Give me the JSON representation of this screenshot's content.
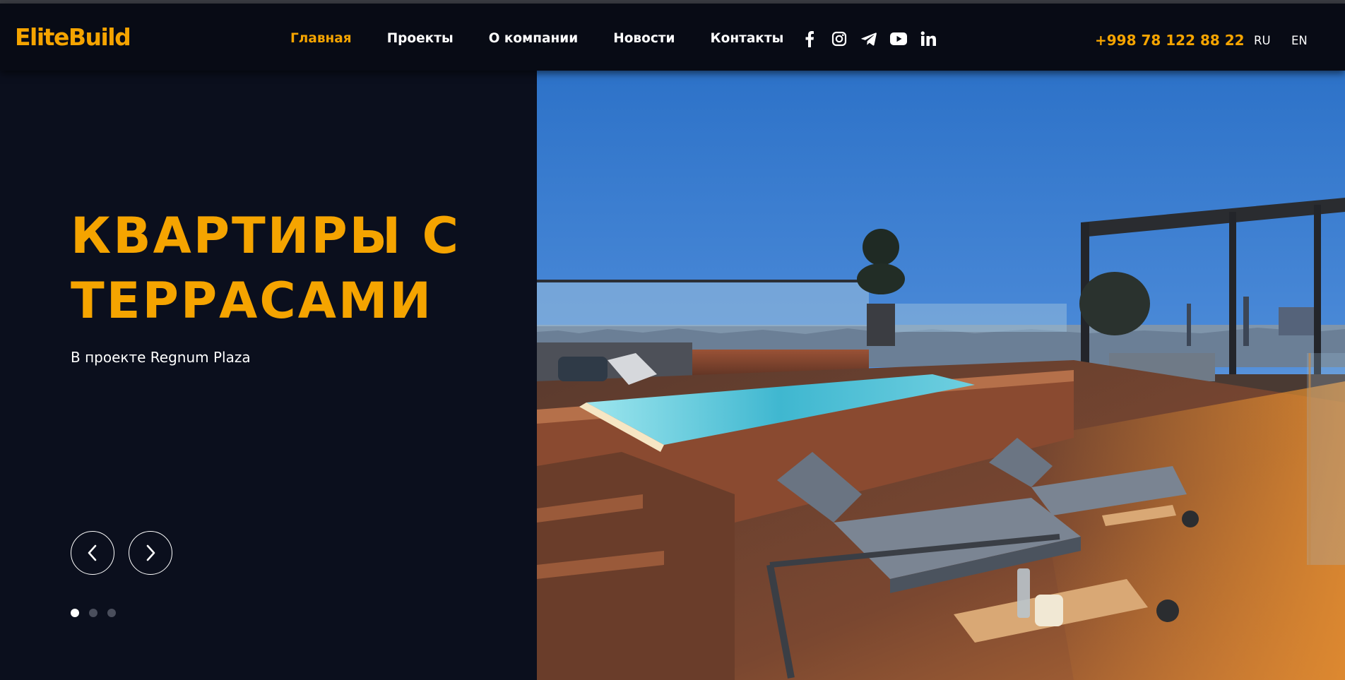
{
  "header": {
    "logo": "EliteBuild",
    "nav": [
      {
        "label": "Главная",
        "active": true
      },
      {
        "label": "Проекты",
        "active": false
      },
      {
        "label": "О компании",
        "active": false
      },
      {
        "label": "Новости",
        "active": false
      },
      {
        "label": "Контакты",
        "active": false
      }
    ],
    "socials": [
      "facebook-icon",
      "instagram-icon",
      "telegram-icon",
      "youtube-icon",
      "linkedin-icon"
    ],
    "phone": "+998 78 122 88 22",
    "languages": [
      "RU",
      "EN"
    ]
  },
  "hero": {
    "title": "Квартиры с террасами",
    "subtitle": "В проекте Regnum Plaza",
    "slider": {
      "current": 1,
      "total": 3,
      "prev_icon": "chevron-left-icon",
      "next_icon": "chevron-right-icon"
    },
    "image": "rooftop-terrace-pool-photo"
  },
  "colors": {
    "accent": "#f5a400",
    "background": "#0b0f1d",
    "header": "#080b15"
  }
}
